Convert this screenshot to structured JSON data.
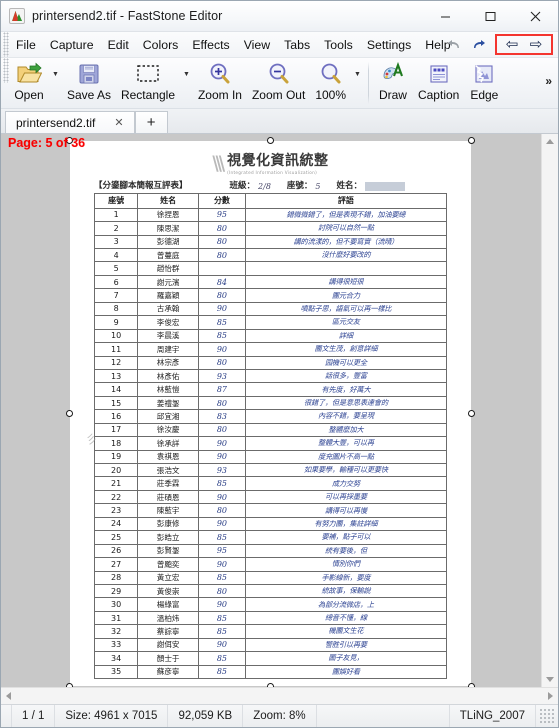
{
  "window": {
    "title": "printersend2.tif - FastStone Editor",
    "app_icon": "faststone-logo-icon",
    "minimize_label": "—",
    "maximize_label": "☐",
    "close_label": "✕"
  },
  "menu": {
    "items": [
      "File",
      "Capture",
      "Edit",
      "Colors",
      "Effects",
      "View",
      "Tabs",
      "Tools",
      "Settings",
      "Help"
    ],
    "undo_icon": "undo-arrow-icon",
    "redo_icon": "redo-arrow-icon",
    "nav_prev_icon": "⇦",
    "nav_next_icon": "⇨",
    "highlight_color": "#f4352f"
  },
  "toolbar": {
    "items": [
      {
        "label": "Open",
        "icon": "open-folder-icon",
        "dropdown": true
      },
      {
        "label": "Save As",
        "icon": "floppy-disk-icon",
        "dropdown": false
      },
      {
        "label": "Rectangle",
        "icon": "marquee-select-icon",
        "dropdown": true
      },
      {
        "label": "Zoom In",
        "icon": "magnifier-plus-icon",
        "dropdown": false
      },
      {
        "label": "Zoom Out",
        "icon": "magnifier-minus-icon",
        "dropdown": false
      },
      {
        "label": "100%",
        "icon": "magnifier-icon",
        "dropdown": true
      },
      {
        "label": "Draw",
        "icon": "draw-palette-icon",
        "dropdown": false
      },
      {
        "label": "Caption",
        "icon": "caption-icon",
        "dropdown": false
      },
      {
        "label": "Edge",
        "icon": "edge-effect-icon",
        "dropdown": false
      }
    ],
    "overflow_label": "»"
  },
  "tabs": {
    "open": [
      {
        "label": "printersend2.tif",
        "close": "✕"
      }
    ],
    "new_tab_label": "+"
  },
  "canvas": {
    "page_overlay_label": "Page: 5 of 36",
    "page_overlay_color": "#f90000"
  },
  "statusbar": {
    "page_counter": "1 / 1",
    "size": "Size: 4961 x 7015",
    "filesize": "92,059 KB",
    "zoom": "Zoom: 8%",
    "profile": "TLiNG_2007"
  },
  "document": {
    "logo_mark": "\\\\\\",
    "title": "視覺化資訊統整",
    "subtitle": "(Integrated Information Visualization)",
    "form_title": "【分鎏腳本簡報互評表】",
    "class_label": "班級：",
    "class_value": "2/8",
    "seat_label": "座號：",
    "seat_value": "5",
    "name_label": "姓名：",
    "name_value": "",
    "columns": [
      "座號",
      "姓名",
      "分數",
      "評語"
    ],
    "rows": [
      {
        "no": "1",
        "name": "徐捏恩",
        "score": "95",
        "comment": "錯微微錯了，但是表現不錯，加油要總"
      },
      {
        "no": "2",
        "name": "陳思潔",
        "score": "80",
        "comment": "討院可以自然一點"
      },
      {
        "no": "3",
        "name": "彭德湖",
        "score": "80",
        "comment": "講的流漾的，但不要寫實（流晴）"
      },
      {
        "no": "4",
        "name": "曾蔓庭",
        "score": "80",
        "comment": "沒什麼好要改的"
      },
      {
        "no": "5",
        "name": "趙怡群",
        "score": "",
        "comment": ""
      },
      {
        "no": "6",
        "name": "謝元濱",
        "score": "84",
        "comment": "講得很短很"
      },
      {
        "no": "7",
        "name": "羅嘉穎",
        "score": "80",
        "comment": "團元合力"
      },
      {
        "no": "8",
        "name": "古承翰",
        "score": "90",
        "comment": "噴點子思，語氣可以再一樣比"
      },
      {
        "no": "9",
        "name": "李俊宏",
        "score": "85",
        "comment": "區元交友"
      },
      {
        "no": "10",
        "name": "李晨溪",
        "score": "85",
        "comment": "詳細"
      },
      {
        "no": "11",
        "name": "周建宇",
        "score": "90",
        "comment": "團文生茂，創意詳細"
      },
      {
        "no": "12",
        "name": "林宗彥",
        "score": "80",
        "comment": "园機可以更全"
      },
      {
        "no": "13",
        "name": "林彥佑",
        "score": "93",
        "comment": "話很多，豐富"
      },
      {
        "no": "14",
        "name": "林藍愷",
        "score": "87",
        "comment": "有先度，好萬大"
      },
      {
        "no": "15",
        "name": "姜禮銞",
        "score": "80",
        "comment": "很錯了，但是意思表達會的"
      },
      {
        "no": "16",
        "name": "邱宜湘",
        "score": "83",
        "comment": "內容不錯，要呈現"
      },
      {
        "no": "17",
        "name": "徐汝慶",
        "score": "80",
        "comment": "整體麼加大"
      },
      {
        "no": "18",
        "name": "徐承詳",
        "score": "90",
        "comment": "整體大豐，可以再"
      },
      {
        "no": "19",
        "name": "袁祺恩",
        "score": "90",
        "comment": "度充圖片不高一點"
      },
      {
        "no": "20",
        "name": "張浩文",
        "score": "93",
        "comment": "如果要學，輸種可以更要快"
      },
      {
        "no": "21",
        "name": "莊季霖",
        "score": "85",
        "comment": "成力交努"
      },
      {
        "no": "22",
        "name": "莊碩恩",
        "score": "90",
        "comment": "可以再採墨要"
      },
      {
        "no": "23",
        "name": "陳藍宇",
        "score": "80",
        "comment": "講得可以再慢"
      },
      {
        "no": "24",
        "name": "彭康修",
        "score": "90",
        "comment": "有努力團，集註詳細"
      },
      {
        "no": "25",
        "name": "彭皓立",
        "score": "85",
        "comment": "要補，點子可以"
      },
      {
        "no": "26",
        "name": "彭賢銞",
        "score": "95",
        "comment": "統有要後，但"
      },
      {
        "no": "27",
        "name": "曾颮奕",
        "score": "90",
        "comment": "情別你們"
      },
      {
        "no": "28",
        "name": "黃立宏",
        "score": "85",
        "comment": "手影線新，要度"
      },
      {
        "no": "29",
        "name": "黃俊崇",
        "score": "80",
        "comment": "統故事，保輸說"
      },
      {
        "no": "30",
        "name": "楊綠富",
        "score": "90",
        "comment": "為部分流微店，上"
      },
      {
        "no": "31",
        "name": "溫柏炜",
        "score": "85",
        "comment": "總音不懂，線"
      },
      {
        "no": "32",
        "name": "蔡誴寧",
        "score": "85",
        "comment": "機團文生花"
      },
      {
        "no": "33",
        "name": "謝佴安",
        "score": "90",
        "comment": "警胜引以再要"
      },
      {
        "no": "34",
        "name": "顏士于",
        "score": "85",
        "comment": "圖子友見，"
      },
      {
        "no": "35",
        "name": "蘇彦寧",
        "score": "85",
        "comment": "團娛好看"
      }
    ]
  }
}
